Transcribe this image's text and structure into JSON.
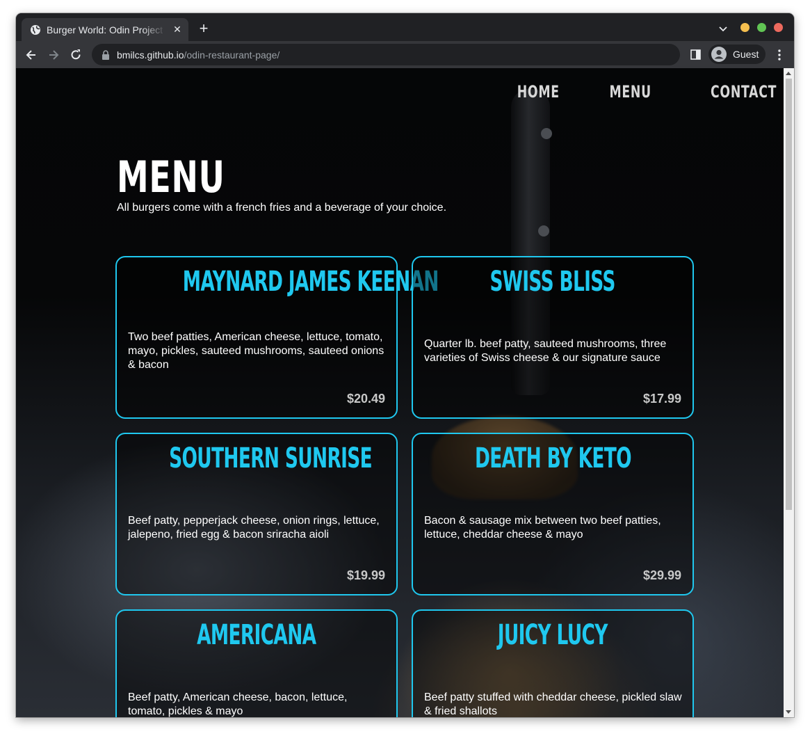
{
  "browser": {
    "tab_title": "Burger World: Odin Project",
    "tab_close": "✕",
    "new_tab": "+",
    "url_host": "bmilcs.github.io",
    "url_path": "/odin-restaurant-page/",
    "profile_label": "Guest",
    "colors": {
      "close": "#ed6a5e",
      "minimize": "#f5bf4f",
      "maximize": "#61c554"
    }
  },
  "nav": {
    "home": "HOME",
    "menu": "MENU",
    "contact": "CONTACT"
  },
  "page": {
    "title": "MENU",
    "subtitle": "All burgers come with a french fries and a beverage of your choice.",
    "accent": "#1fc8ef"
  },
  "menu_items": [
    {
      "name": "MAYNARD JAMES KEENAN",
      "description": "Two beef patties, American cheese, lettuce, tomato, mayo, pickles, sauteed mushrooms, sauteed onions & bacon",
      "price": "$20.49"
    },
    {
      "name": "SWISS BLISS",
      "description": "Quarter lb. beef patty, sauteed mushrooms, three varieties of Swiss cheese & our signature sauce",
      "price": "$17.99"
    },
    {
      "name": "SOUTHERN SUNRISE",
      "description": "Beef patty, pepperjack cheese, onion rings, lettuce, jalepeno, fried egg & bacon sriracha aioli",
      "price": "$19.99"
    },
    {
      "name": "DEATH BY KETO",
      "description": "Bacon & sausage mix between two beef patties, lettuce, cheddar cheese & mayo",
      "price": "$29.99"
    },
    {
      "name": "AMERICANA",
      "description": "Beef patty, American cheese, bacon, lettuce, tomato, pickles & mayo",
      "price": ""
    },
    {
      "name": "JUICY LUCY",
      "description": "Beef patty stuffed with cheddar cheese, pickled slaw & fried shallots",
      "price": ""
    }
  ]
}
